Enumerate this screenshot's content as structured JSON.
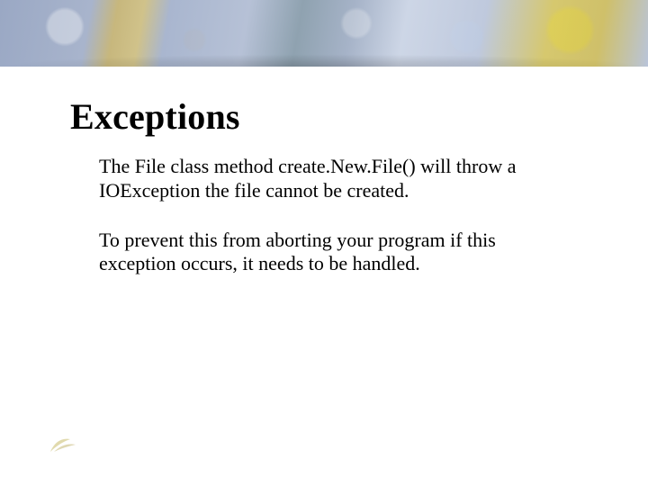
{
  "title": "Exceptions",
  "paragraph1": "The File class method create.New.File() will throw a IOException the file cannot be created.",
  "paragraph2": "To prevent this from aborting your program if this exception occurs, it needs to be handled."
}
